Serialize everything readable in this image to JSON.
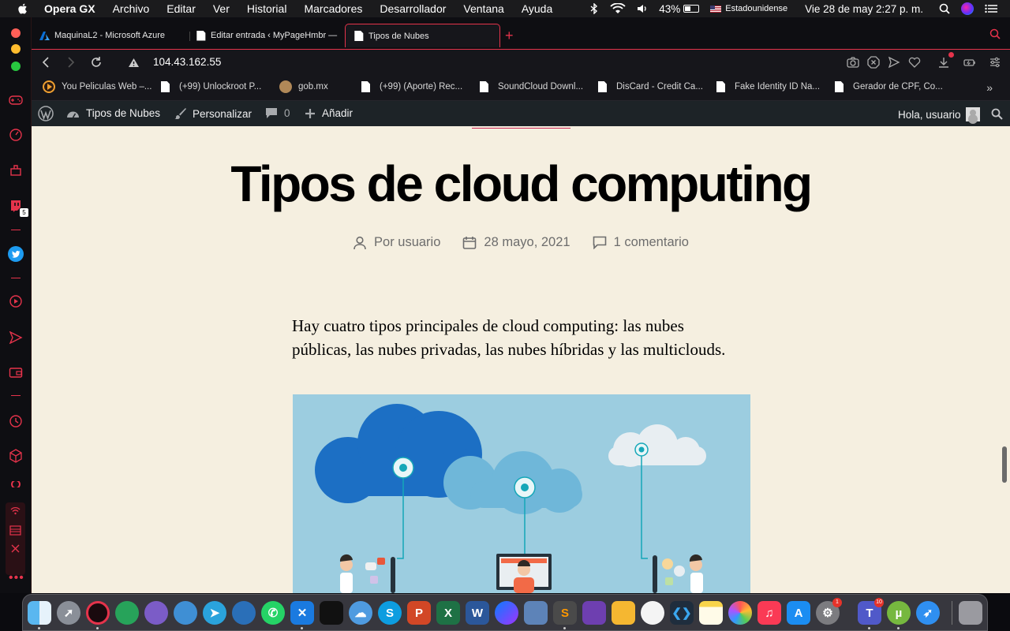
{
  "menubar": {
    "app_name": "Opera GX",
    "items": [
      "Archivo",
      "Editar",
      "Ver",
      "Historial",
      "Marcadores",
      "Desarrollador",
      "Ventana",
      "Ayuda"
    ],
    "battery_percent": "43%",
    "battery_level": 0.43,
    "input_source": "Estadounidense",
    "datetime": "Vie 28 de may  2:27 p. m."
  },
  "tabs": [
    {
      "title": "MaquinaL2 - Microsoft Azure",
      "active": false
    },
    {
      "title": "Editar entrada ‹ MyPageHmbr —",
      "active": false
    },
    {
      "title": "Tipos de Nubes",
      "active": true
    }
  ],
  "address": {
    "url": "104.43.162.55",
    "security": "not-secure"
  },
  "bookmarks": [
    {
      "label": "You Peliculas Web –...",
      "icon": "play-circle-icon"
    },
    {
      "label": "(+99) Unlockroot P...",
      "icon": "document-icon"
    },
    {
      "label": "gob.mx",
      "icon": "seal-icon"
    },
    {
      "label": "(+99) (Aporte) Rec...",
      "icon": "document-icon"
    },
    {
      "label": "SoundCloud Downl...",
      "icon": "document-icon"
    },
    {
      "label": "DisCard - Credit Ca...",
      "icon": "document-icon"
    },
    {
      "label": "Fake Identity ID Na...",
      "icon": "document-icon"
    },
    {
      "label": "Gerador de CPF, Co...",
      "icon": "document-icon"
    }
  ],
  "sidebar": {
    "twitch_badge": "5"
  },
  "wpadmin": {
    "site_name": "Tipos de Nubes",
    "customize": "Personalizar",
    "comments_count": "0",
    "add_new": "Añadir",
    "greeting": "Hola, usuario"
  },
  "post": {
    "title": "Tipos de cloud computing",
    "author": "Por usuario",
    "date": "28 mayo, 2021",
    "comments": "1 comentario",
    "intro": "Hay cuatro tipos principales de cloud computing: las nubes públicas, las nubes privadas, las nubes híbridas y las multiclouds."
  },
  "dock": {
    "apps": [
      "Finder",
      "Launchpad",
      "Opera GX",
      "App verde",
      "App morada",
      "App azul",
      "Telegram",
      "App nube",
      "WhatsApp",
      "Xcode",
      "App negra",
      "App nube 2",
      "Skype",
      "PowerPoint",
      "Excel",
      "Word",
      "Messenger",
      "Preview",
      "Sublime Text",
      "GitHub Desktop",
      "App amarilla",
      "App montaña",
      "VS Code",
      "Notas",
      "Fotos",
      "Música",
      "App Store",
      "Preferencias del Sistema",
      "Teams",
      "uTorrent",
      "Safari",
      "Papelera"
    ],
    "settings_badge": "1",
    "teams_badge": "10"
  },
  "colors": {
    "opera_accent": "#e5334b",
    "page_background": "#f5efe0",
    "wp_admin": "#1d2327"
  }
}
